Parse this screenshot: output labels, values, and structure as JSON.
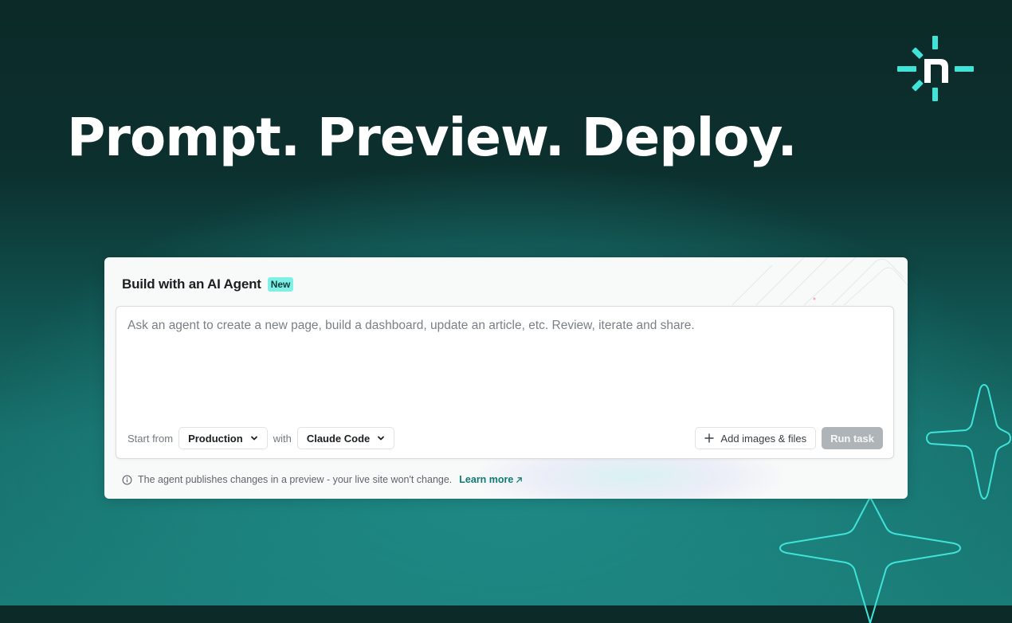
{
  "hero": {
    "headline": "Prompt. Preview. Deploy."
  },
  "brand": {
    "logo_icon": "netlify-logo-icon",
    "accent_color": "#3fe3d8"
  },
  "card": {
    "title": "Build with an AI Agent",
    "badge": "New",
    "prompt": {
      "value": "",
      "placeholder": "Ask an agent to create a new page, build a dashboard, update an article, etc. Review, iterate and share."
    },
    "start_from_label": "Start from",
    "environment_selected": "Production",
    "with_label": "with",
    "agent_selected": "Claude Code",
    "add_files_label": "Add images & files",
    "run_label": "Run task",
    "footnote": "The agent publishes changes in a preview - your live site won't change.",
    "learn_more": "Learn more"
  },
  "colors": {
    "badge_bg": "#7ef0e6",
    "link": "#0f7a73",
    "run_disabled_bg": "#aeb4b8"
  }
}
